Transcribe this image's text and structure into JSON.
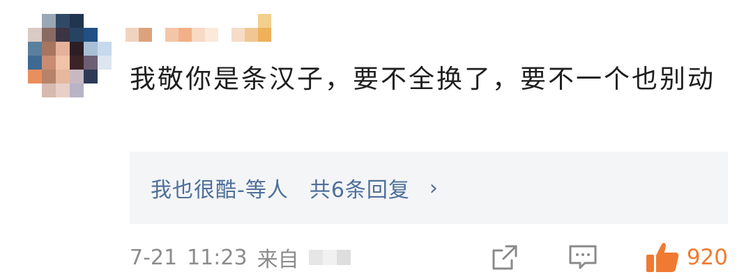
{
  "comment": {
    "text": "我敬你是条汉子，要不全换了，要不一个也别动",
    "reply_preview": {
      "user": "我也很酷-等人",
      "action": "共6条回复",
      "chevron": "›"
    },
    "footer": {
      "date": "7-21",
      "time": "11:23",
      "from_label": "来自",
      "like_count": "920"
    }
  },
  "icons": {
    "share": "share-icon",
    "comment": "comment-icon",
    "like": "thumbs-up-icon",
    "chevron": "chevron-right-icon"
  },
  "colors": {
    "text": "#1f1f1f",
    "link": "#4e6f9a",
    "meta": "#8c8c8c",
    "like": "#f07a31",
    "reply_bg": "#f4f5f7"
  }
}
